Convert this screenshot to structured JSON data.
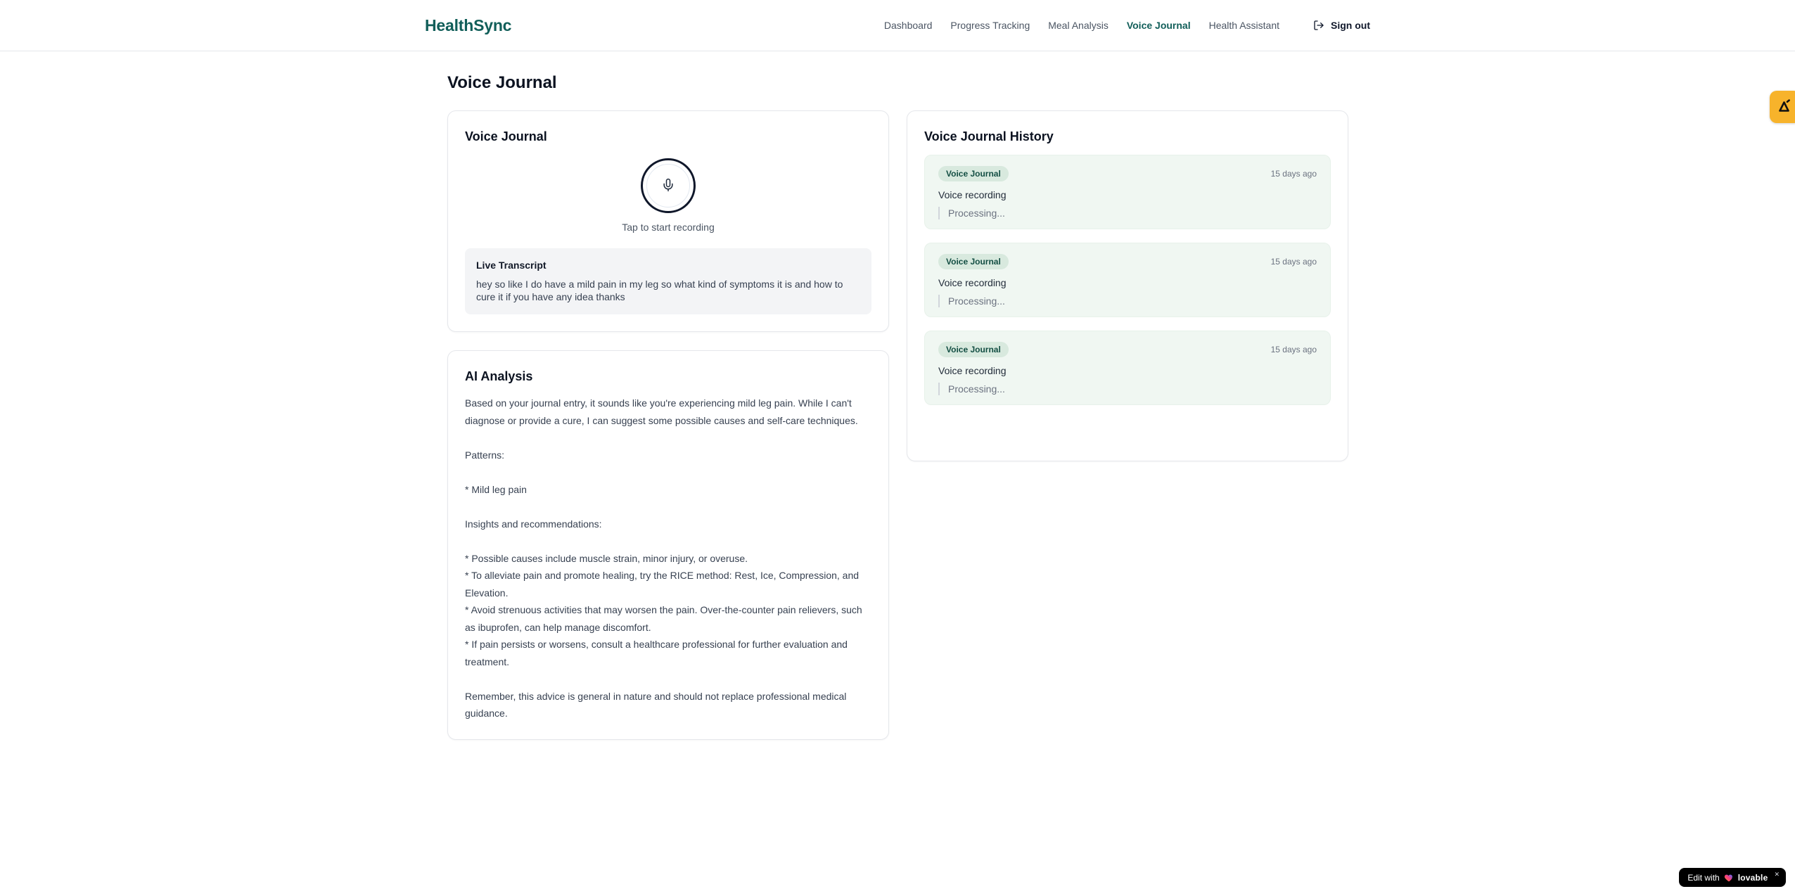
{
  "brand": {
    "name": "HealthSync"
  },
  "nav": {
    "items": [
      {
        "label": "Dashboard"
      },
      {
        "label": "Progress Tracking"
      },
      {
        "label": "Meal Analysis"
      },
      {
        "label": "Voice Journal"
      },
      {
        "label": "Health Assistant"
      }
    ],
    "sign_out_label": "Sign out"
  },
  "page": {
    "title": "Voice Journal"
  },
  "recorder": {
    "card_title": "Voice Journal",
    "tap_label": "Tap to start recording",
    "transcript_title": "Live Transcript",
    "transcript_text": "hey so like I do have a mild pain in my leg so what kind of symptoms it is and how to cure it if you have any idea thanks"
  },
  "analysis": {
    "card_title": "AI Analysis",
    "body": "Based on your journal entry, it sounds like you're experiencing mild leg pain. While I can't diagnose or provide a cure, I can suggest some possible causes and self-care techniques.\n\nPatterns:\n\n* Mild leg pain\n\nInsights and recommendations:\n\n* Possible causes include muscle strain, minor injury, or overuse.\n* To alleviate pain and promote healing, try the RICE method: Rest, Ice, Compression, and Elevation.\n* Avoid strenuous activities that may worsen the pain. Over-the-counter pain relievers, such as ibuprofen, can help manage discomfort.\n* If pain persists or worsens, consult a healthcare professional for further evaluation and treatment.\n\nRemember, this advice is general in nature and should not replace professional medical guidance."
  },
  "history": {
    "card_title": "Voice Journal History",
    "entries": [
      {
        "badge": "Voice Journal",
        "time": "15 days ago",
        "title": "Voice recording",
        "status": "Processing..."
      },
      {
        "badge": "Voice Journal",
        "time": "15 days ago",
        "title": "Voice recording",
        "status": "Processing..."
      },
      {
        "badge": "Voice Journal",
        "time": "15 days ago",
        "title": "Voice recording",
        "status": "Processing..."
      }
    ]
  },
  "floating": {
    "pill_prefix": "Edit with",
    "pill_brand": "lovable",
    "pill_close": "✕"
  },
  "colors": {
    "brand_teal": "#115e59",
    "entry_bg": "#f0f7f2",
    "badge_bg": "#d8e9de",
    "badge_text": "#134e43",
    "amber_badge": "#f7b32b"
  }
}
